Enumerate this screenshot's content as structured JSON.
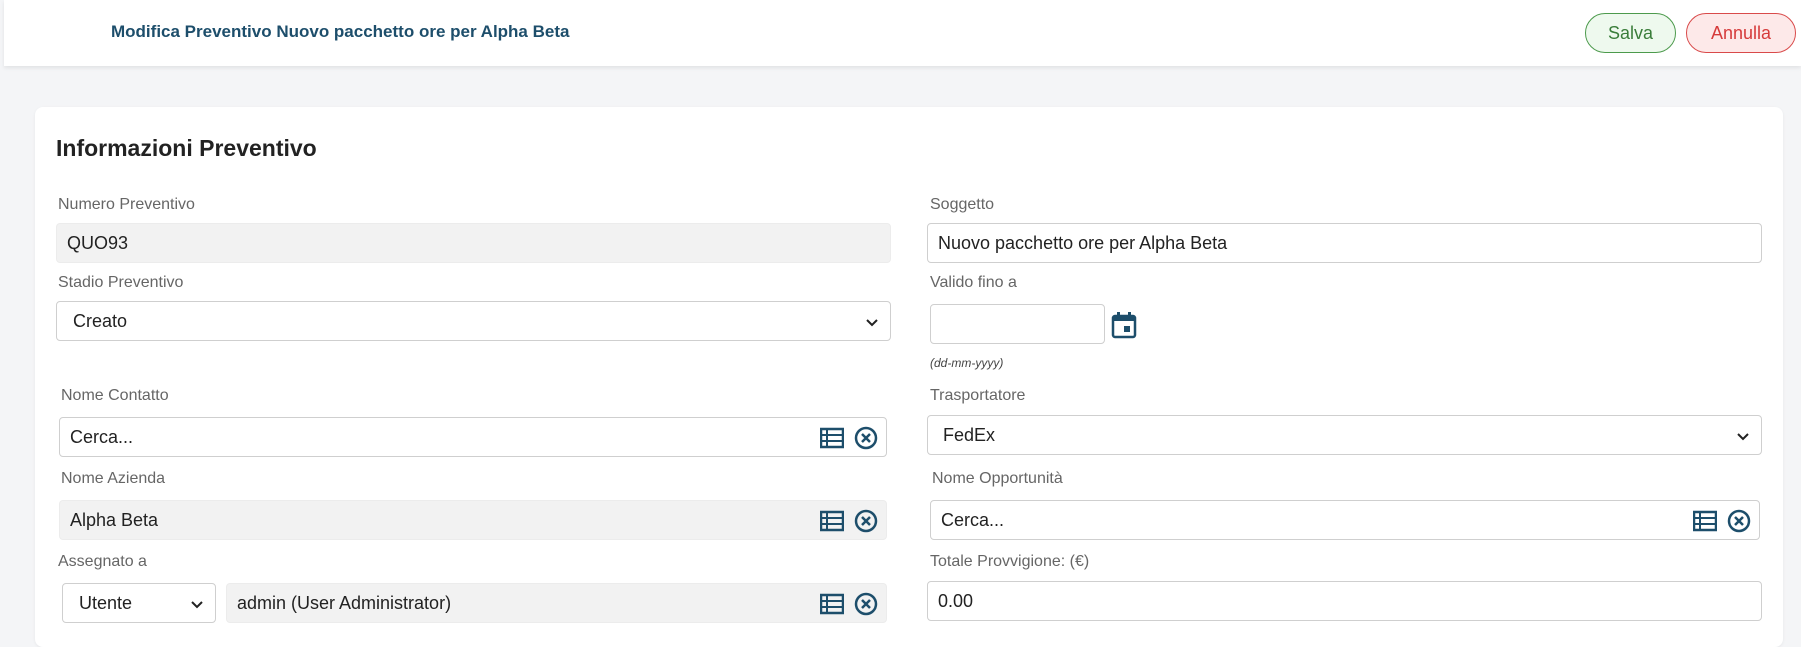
{
  "header": {
    "title": "Modifica Preventivo Nuovo pacchetto ore per Alpha Beta",
    "save_label": "Salva",
    "cancel_label": "Annulla"
  },
  "section": {
    "title": "Informazioni Preventivo"
  },
  "fields": {
    "numero_preventivo": {
      "label": "Numero Preventivo",
      "value": "QUO93"
    },
    "soggetto": {
      "label": "Soggetto",
      "value": "Nuovo pacchetto ore per Alpha Beta"
    },
    "stadio_preventivo": {
      "label": "Stadio Preventivo",
      "value": "Creato"
    },
    "valido_fino_a": {
      "label": "Valido fino a",
      "value": "",
      "hint": "(dd-mm-yyyy)"
    },
    "nome_contatto": {
      "label": "Nome Contatto",
      "placeholder": "Cerca..."
    },
    "trasportatore": {
      "label": "Trasportatore",
      "value": "FedEx"
    },
    "nome_azienda": {
      "label": "Nome Azienda",
      "value": "Alpha Beta"
    },
    "nome_opportunita": {
      "label": "Nome Opportunità",
      "placeholder": "Cerca..."
    },
    "assegnato_a": {
      "label": "Assegnato a",
      "type_value": "Utente",
      "value": "admin (User Administrator)"
    },
    "totale_provvigione": {
      "label": "Totale Provvigione: (€)",
      "value": "0.00"
    }
  },
  "colors": {
    "primary": "#1d4e6b",
    "save_green": "#3a7d3a",
    "cancel_red": "#d63b3b"
  },
  "icons": [
    "list-icon",
    "clear-circle-icon",
    "calendar-icon",
    "chevron-down-icon"
  ]
}
